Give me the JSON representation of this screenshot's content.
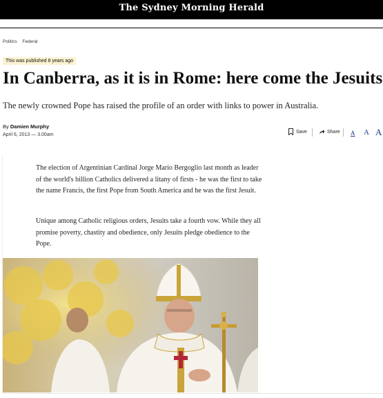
{
  "masthead": "The Sydney Morning Herald",
  "breadcrumb": [
    "Politics",
    "Federal"
  ],
  "badge": "This was published 8 years ago",
  "headline": "In Canberra, as it is in Rome: here come the Jesuits",
  "dek": "The newly crowned Pope has raised the profile of an order with links to power in Australia.",
  "byline": {
    "prefix": "By",
    "author": "Damien Murphy"
  },
  "date": "April 6, 2013 — 3.00am",
  "actions": {
    "save": "Save",
    "share": "Share"
  },
  "text_size": [
    "A",
    "A",
    "A"
  ],
  "paragraphs": [
    "The election of Argentinian Cardinal Jorge Mario Bergoglio last month as leader of the world's billion Catholics delivered a litany of firsts - he was the first to take the name Francis, the first Pope from South America and he was the first Jesuit.",
    "Unique among Catholic religious orders, Jesuits take a fourth vow. While they all promise poverty, chastity and obedience, only Jesuits pledge obedience to the Pope."
  ],
  "colors": {
    "accent": "#1a3a8a",
    "badge_bg": "#fbf2d0",
    "masthead_bg": "#000000"
  }
}
